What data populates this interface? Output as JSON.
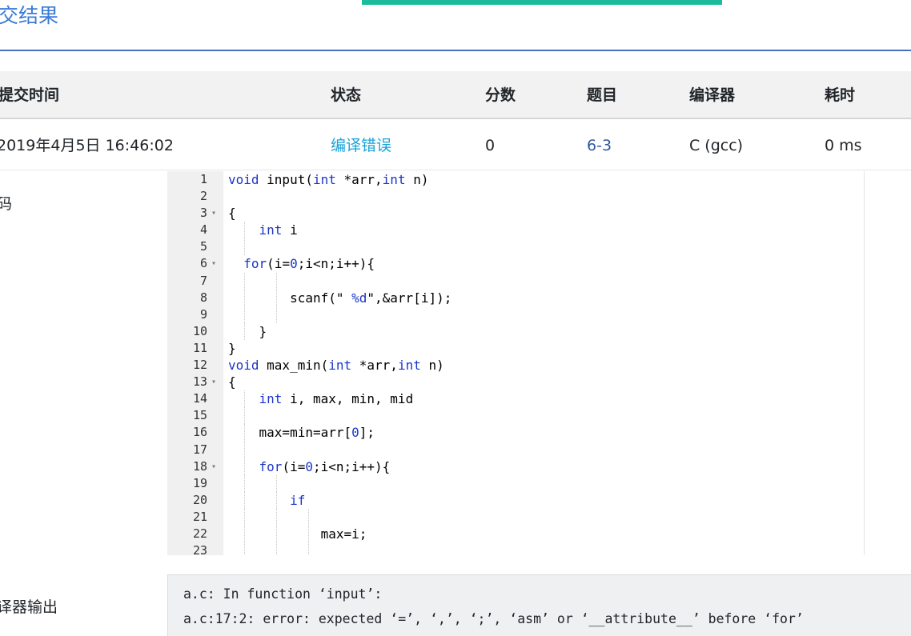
{
  "page": {
    "heading": "交结果"
  },
  "table": {
    "headers": {
      "submit_time": "提交时间",
      "status": "状态",
      "score": "分数",
      "problem": "题目",
      "compiler": "编译器",
      "time_cost": "耗时"
    },
    "row": {
      "submit_time": "2019年4月5日 16:46:02",
      "status": "编译错误",
      "score": "0",
      "problem": "6-3",
      "compiler": "C (gcc)",
      "time_cost": "0 ms"
    }
  },
  "sections": {
    "code_label": "码",
    "compiler_output_label": "译器输出"
  },
  "code": {
    "lines": [
      {
        "n": "1",
        "fold": "",
        "text": "void input(int *arr,int n)"
      },
      {
        "n": "2",
        "fold": "",
        "text": ""
      },
      {
        "n": "3",
        "fold": "▾",
        "text": "{"
      },
      {
        "n": "4",
        "fold": "",
        "text": "    int i"
      },
      {
        "n": "5",
        "fold": "",
        "text": ""
      },
      {
        "n": "6",
        "fold": "▾",
        "text": "  for(i=0;i<n;i++){"
      },
      {
        "n": "7",
        "fold": "",
        "text": ""
      },
      {
        "n": "8",
        "fold": "",
        "text": "        scanf(\" %d\",&arr[i]);"
      },
      {
        "n": "9",
        "fold": "",
        "text": ""
      },
      {
        "n": "10",
        "fold": "",
        "text": "    }"
      },
      {
        "n": "11",
        "fold": "",
        "text": "}"
      },
      {
        "n": "12",
        "fold": "",
        "text": "void max_min(int *arr,int n)"
      },
      {
        "n": "13",
        "fold": "▾",
        "text": "{"
      },
      {
        "n": "14",
        "fold": "",
        "text": "    int i, max, min, mid"
      },
      {
        "n": "15",
        "fold": "",
        "text": ""
      },
      {
        "n": "16",
        "fold": "",
        "text": "    max=min=arr[0];"
      },
      {
        "n": "17",
        "fold": "",
        "text": ""
      },
      {
        "n": "18",
        "fold": "▾",
        "text": "    for(i=0;i<n;i++){"
      },
      {
        "n": "19",
        "fold": "",
        "text": ""
      },
      {
        "n": "20",
        "fold": "",
        "text": "        if"
      },
      {
        "n": "21",
        "fold": "",
        "text": ""
      },
      {
        "n": "22",
        "fold": "",
        "text": "            max=i;"
      },
      {
        "n": "23",
        "fold": "",
        "text": ""
      }
    ]
  },
  "compiler_output": {
    "line1": "a.c: In function ‘input’:",
    "line2": "a.c:17:2: error: expected ‘=’, ‘,’, ‘;’, ‘asm’ or ‘__attribute__’ before ‘for’"
  },
  "colors": {
    "accent_bar": "#1abc9c",
    "heading": "#3a7bd5",
    "status_error": "#17a2d8",
    "keyword": "#1a35c9"
  }
}
